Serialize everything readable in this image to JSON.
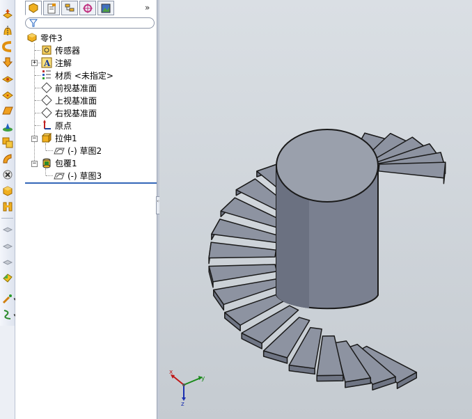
{
  "toolbar": {
    "tools": [
      {
        "name": "extruded-boss-icon"
      },
      {
        "name": "revolved-boss-icon"
      },
      {
        "name": "swept-boss-icon"
      },
      {
        "name": "extruded-cut-icon"
      },
      {
        "name": "fillet-icon"
      },
      {
        "name": "chamfer-icon"
      },
      {
        "name": "reference-plane-icon"
      },
      {
        "name": "linear-pattern-icon"
      },
      {
        "name": "shell-icon"
      },
      {
        "name": "draft-icon"
      },
      {
        "name": "intersect-icon"
      },
      {
        "name": "dome-icon"
      },
      {
        "name": "rib-icon"
      },
      {
        "name": "wrap-icon"
      },
      {
        "name": "flex-icon"
      },
      {
        "name": "deform-icon"
      },
      {
        "name": "indent-icon"
      },
      {
        "name": "sketch-dropdown-icon"
      },
      {
        "name": "curves-dropdown-icon"
      }
    ]
  },
  "panel_tabs": [
    {
      "name": "feature-manager-tab"
    },
    {
      "name": "property-manager-tab"
    },
    {
      "name": "configuration-manager-tab"
    },
    {
      "name": "dimxpert-manager-tab"
    },
    {
      "name": "display-manager-tab"
    }
  ],
  "tree": {
    "root": "零件3",
    "sensors": "传感器",
    "annotations": "注解",
    "material": "材质 <未指定>",
    "front_plane": "前视基准面",
    "top_plane": "上视基准面",
    "right_plane": "右视基准面",
    "origin": "原点",
    "extrude1": "拉伸1",
    "extrude1_sketch": "(-) 草图2",
    "wrap1": "包覆1",
    "wrap1_sketch": "(-) 草图3"
  },
  "triad": {
    "x": "x",
    "y": "y",
    "z": "z"
  },
  "colors": {
    "model_fill": "#8d93a1",
    "model_top": "#9a9fab",
    "model_side": "#6f7584",
    "viewport_top": "#dadfe4",
    "viewport_bottom": "#c5cbd1",
    "triad_x": "#c01818",
    "triad_y": "#1a8a1a",
    "triad_z": "#1a2fb0"
  }
}
